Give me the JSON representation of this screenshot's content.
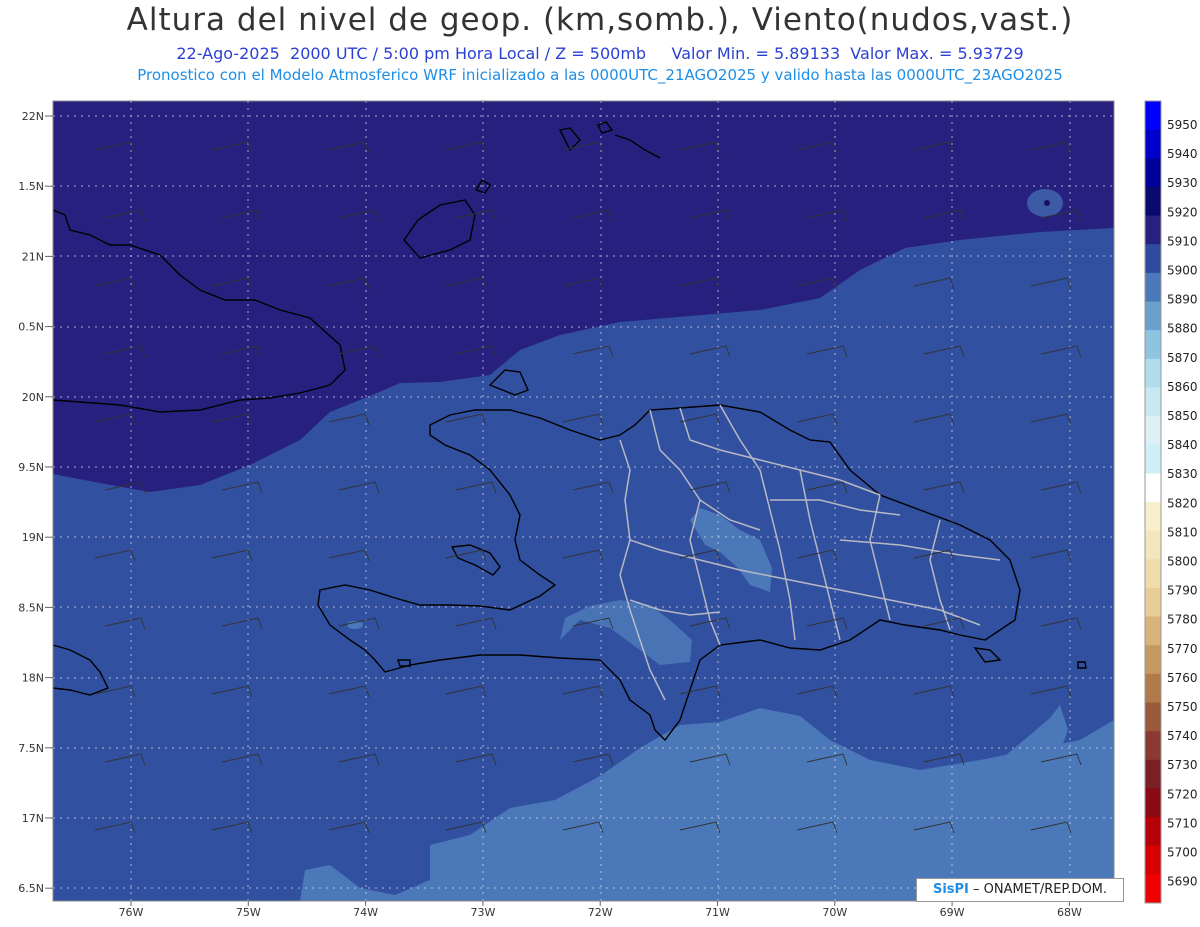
{
  "header": {
    "title": "Altura del nivel de geop. (km,somb.), Viento(nudos,vast.)",
    "subtitle_line1": "22-Ago-2025  2000 UTC / 5:00 pm Hora Local / Z = 500mb     Valor Min. = 5.89133  Valor Max. = 5.93729",
    "subtitle_line2": "Pronostico con el Modelo Atmosferico WRF inicializado a las 0000UTC_21AGO2025 y valido hasta las  0000UTC_23AGO2025"
  },
  "axes": {
    "lat_labels": [
      "22N",
      "1.5N",
      "21N",
      "0.5N",
      "20N",
      "9.5N",
      "19N",
      "8.5N",
      "18N",
      "7.5N",
      "17N",
      "6.5N"
    ],
    "lon_labels": [
      "76W",
      "75W",
      "74W",
      "73W",
      "72W",
      "71W",
      "70W",
      "69W",
      "68W"
    ]
  },
  "colorbar": {
    "levels": [
      "5950",
      "5940",
      "5930",
      "5920",
      "5910",
      "5900",
      "5890",
      "5880",
      "5870",
      "5860",
      "5850",
      "5840",
      "5830",
      "5820",
      "5810",
      "5800",
      "5790",
      "5780",
      "5770",
      "5760",
      "5750",
      "5740",
      "5730",
      "5720",
      "5710",
      "5700",
      "5690"
    ],
    "colors": [
      "#0000ff",
      "#0000cc",
      "#000099",
      "#0a0a6e",
      "#28207e",
      "#2f4ba0",
      "#4a78b8",
      "#6aa0cc",
      "#8ec4e0",
      "#b0dcec",
      "#c8e8f2",
      "#dcf0f6",
      "#d0eef8",
      "#ffffff",
      "#f8efcc",
      "#f4e6bc",
      "#efdcaa",
      "#e8cc96",
      "#d8b47a",
      "#c49a60",
      "#b07a4a",
      "#9c5a3c",
      "#8a3a30",
      "#7a1f26",
      "#8c0a14",
      "#b80008",
      "#d80000",
      "#f00000"
    ]
  },
  "legend_fill_colors": {
    "level_5910_plus": "#28207e",
    "level_5900": "#3250a0",
    "level_5890": "#4a78b8"
  },
  "credit": {
    "logo": "SisPI",
    "text": " – ONAMET/REP.DOM."
  }
}
